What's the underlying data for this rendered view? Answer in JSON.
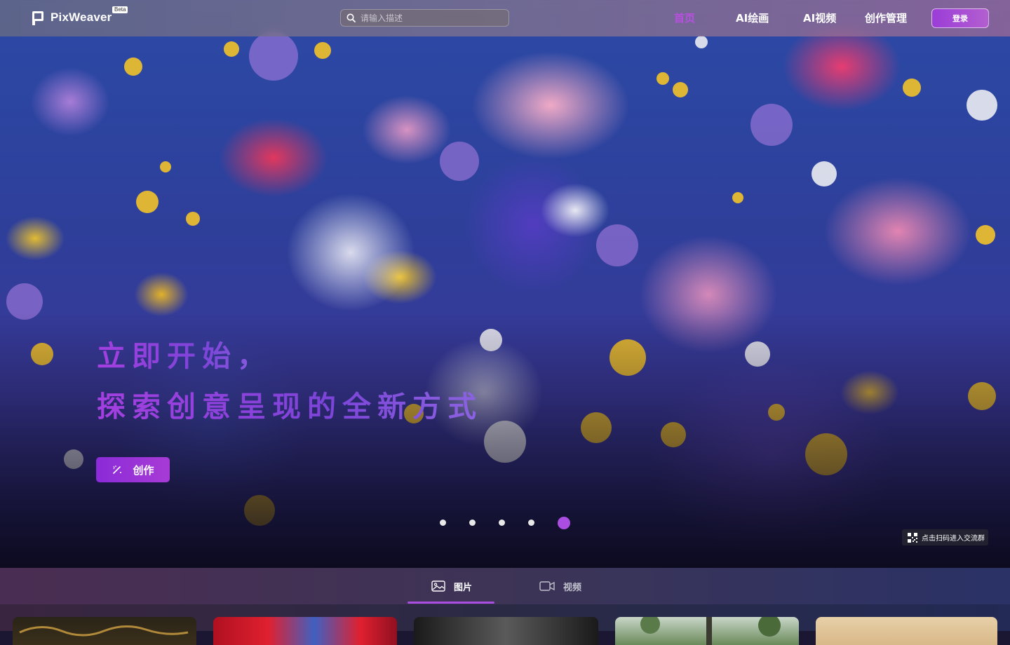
{
  "brand": {
    "name": "PixWeaver",
    "badge": "Beta"
  },
  "search": {
    "placeholder": "请输入描述"
  },
  "nav": {
    "home": "首页",
    "ai_painting": "AI绘画",
    "ai_video": "AI视频",
    "creation_mgmt": "创作管理",
    "login": "登录"
  },
  "hero": {
    "line1": "立即开始，",
    "line2": "探索创意呈现的全新方式",
    "create_button": "创作",
    "carousel_total": 5,
    "carousel_active": 5,
    "qr_text": "点击扫码进入交流群"
  },
  "tabs": {
    "images": "图片",
    "videos": "视频",
    "active": "images"
  },
  "colors": {
    "accent": "#a94ee0",
    "accent_dark": "#8a2bd8",
    "active_nav": "#b84fe0"
  },
  "icons": [
    "logo-icon",
    "search-icon",
    "magic-wand-icon",
    "qr-code-icon",
    "image-icon",
    "video-camera-icon"
  ]
}
